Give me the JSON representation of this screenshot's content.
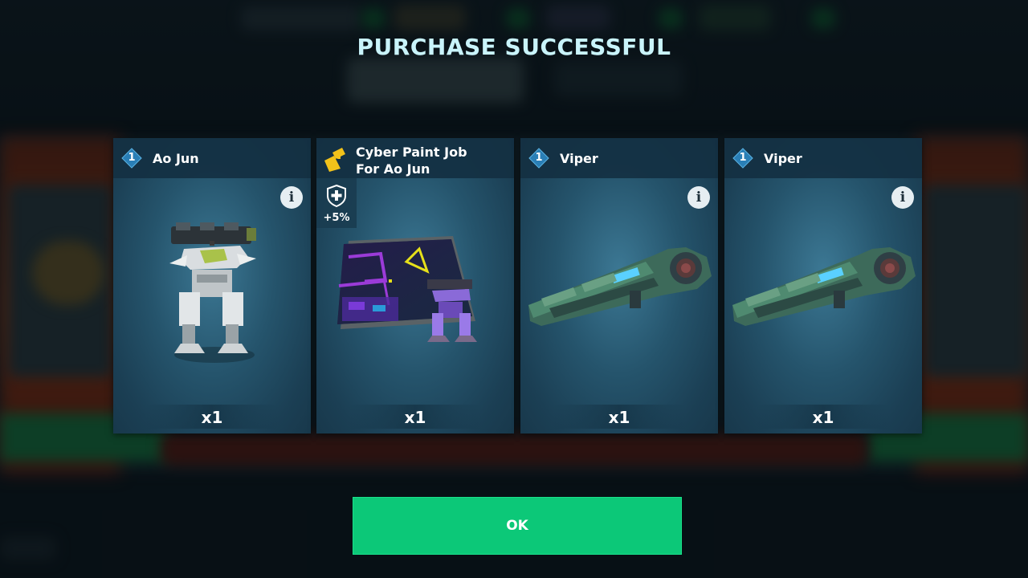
{
  "title": "PURCHASE SUCCESSFUL",
  "cards": [
    {
      "kind": "robot",
      "level": "1",
      "name": "Ao Jun",
      "quantity": "x1",
      "icon": "robot-ao-jun"
    },
    {
      "kind": "paint",
      "name_line1": "Cyber Paint Job",
      "name_line2": "For Ao Jun",
      "bonus": "+5%",
      "quantity": "x1",
      "icon": "paint-can-icon"
    },
    {
      "kind": "weapon",
      "level": "1",
      "name": "Viper",
      "quantity": "x1",
      "icon": "weapon-viper"
    },
    {
      "kind": "weapon",
      "level": "1",
      "name": "Viper",
      "quantity": "x1",
      "icon": "weapon-viper"
    }
  ],
  "ok_button": "OK",
  "colors": {
    "title": "#c9f4fb",
    "ok_button": "#0cc878",
    "level_badge": "#2a7fb6",
    "card_bg": "#25546c"
  }
}
